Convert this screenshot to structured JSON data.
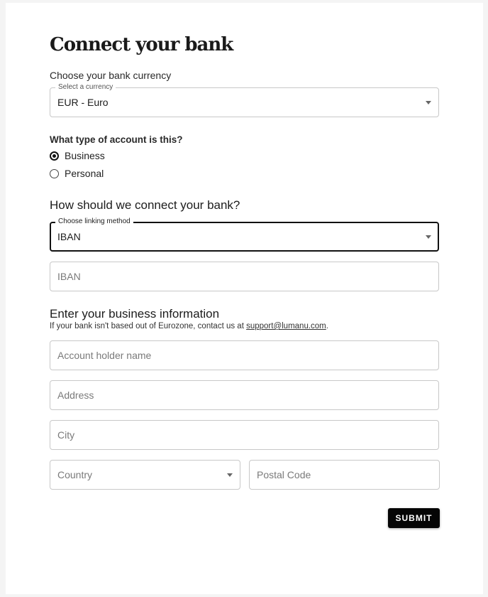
{
  "page": {
    "title": "Connect your bank",
    "currency_prompt": "Choose your bank currency",
    "currency_select": {
      "legend": "Select a currency",
      "value": "EUR - Euro"
    },
    "account_type": {
      "question": "What type of account is this?",
      "options": [
        {
          "label": "Business",
          "checked": true
        },
        {
          "label": "Personal",
          "checked": false
        }
      ]
    },
    "connect_heading": "How should we connect your bank?",
    "linking_select": {
      "legend": "Choose linking method",
      "value": "IBAN"
    },
    "iban_field": {
      "placeholder": "IBAN"
    },
    "business_heading": "Enter your business information",
    "business_hint_prefix": "If your bank isn't based out of Eurozone, contact us at ",
    "support_email": "support@lumanu.com",
    "business_hint_suffix": ".",
    "fields": {
      "account_holder": "Account holder name",
      "address": "Address",
      "city": "City",
      "country": "Country",
      "postal_code": "Postal Code"
    },
    "submit_label": "SUBMIT"
  }
}
